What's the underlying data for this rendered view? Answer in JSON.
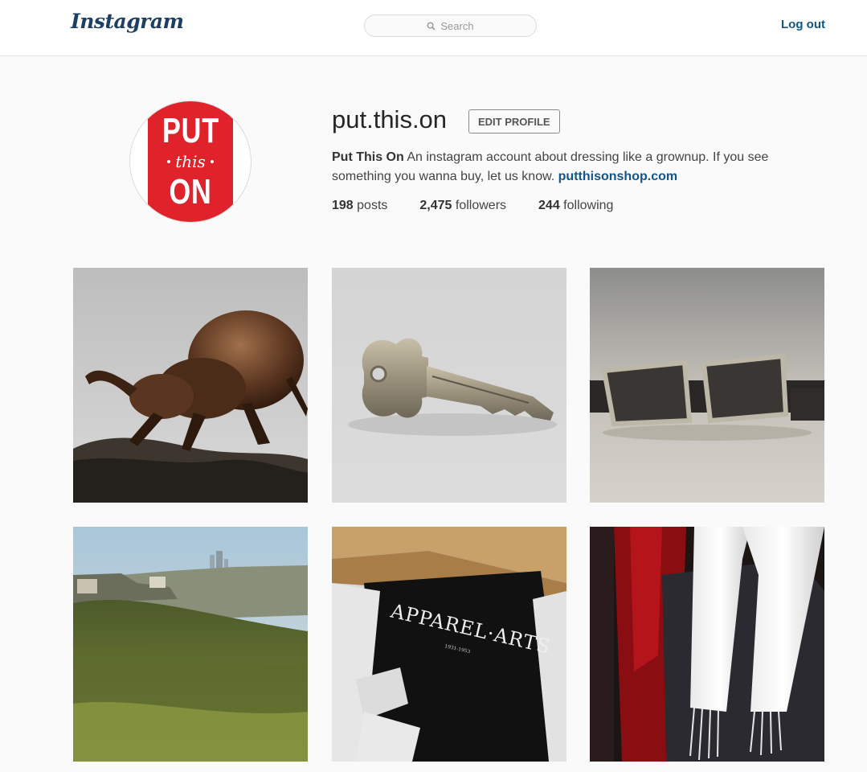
{
  "header": {
    "logo": "Instagram",
    "search_placeholder": "Search",
    "logout_label": "Log out"
  },
  "profile": {
    "avatar": {
      "line1": "PUT",
      "line2": "this",
      "line3": "ON"
    },
    "username": "put.this.on",
    "edit_profile_label": "EDIT PROFILE",
    "bio": {
      "name": "Put This On",
      "text": " An instagram account about dressing like a grownup. If you see something you wanna buy, let us know. ",
      "link": "putthisonshop.com"
    },
    "stats": {
      "posts_count": "198",
      "posts_label": " posts",
      "followers_count": "2,475",
      "followers_label": " followers",
      "following_count": "244",
      "following_label": " following"
    }
  },
  "posts": {
    "post5_text": "APPAREL·ARTS"
  }
}
